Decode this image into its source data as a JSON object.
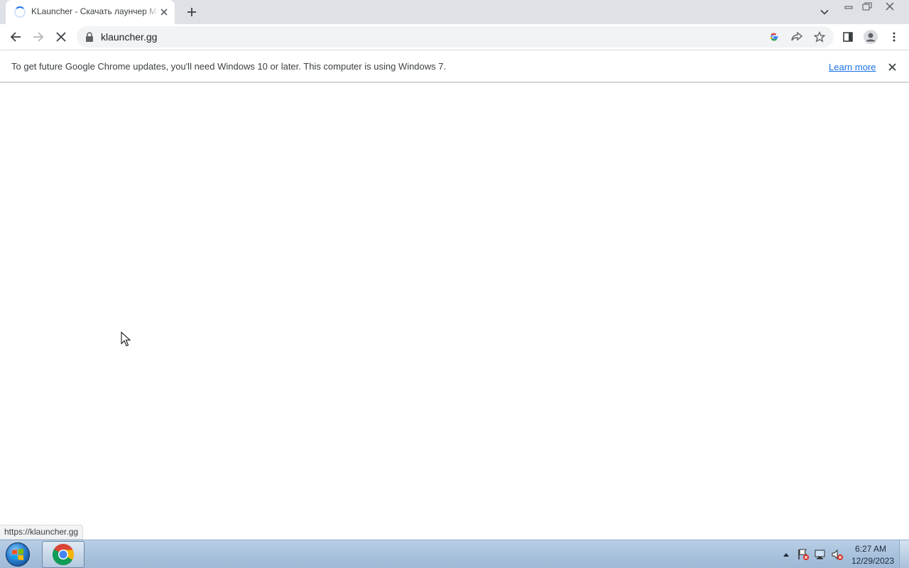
{
  "tab": {
    "title": "KLauncher - Скачать лаунчер Майнкрафт"
  },
  "omnibox": {
    "url": "klauncher.gg"
  },
  "infobar": {
    "message": "To get future Google Chrome updates, you'll need Windows 10 or later. This computer is using Windows 7.",
    "link_label": "Learn more"
  },
  "status_bubble": {
    "url": "https://klauncher.gg"
  },
  "taskbar": {
    "clock_time": "6:27 AM",
    "clock_date": "12/29/2023"
  },
  "colors": {
    "accent": "#1a73e8",
    "tabstrip": "#dee1e6",
    "omnibox": "#f1f3f4"
  }
}
